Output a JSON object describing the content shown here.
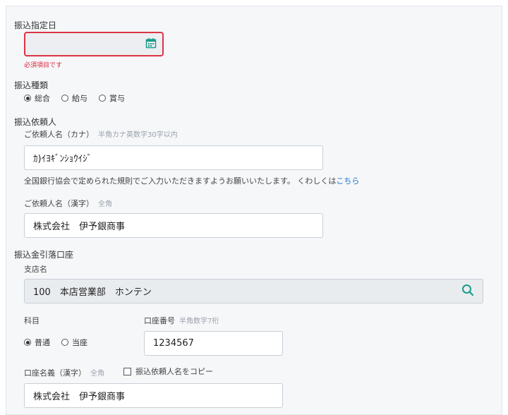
{
  "transfer_date": {
    "label": "振込指定日",
    "value": "",
    "error": "必須項目です"
  },
  "transfer_type": {
    "label": "振込種類",
    "options": [
      "総合",
      "給与",
      "賞与"
    ],
    "selected": 0
  },
  "requester": {
    "label": "振込依頼人",
    "kana": {
      "label": "ご依頼人名（カナ）",
      "hint": "半角カナ英数字30字以内",
      "value": "ｶ)ｲﾖｷﾞﾝｼｮｳｲｼﾞ"
    },
    "notice_text": "全国銀行協会で定められた規則でご入力いただきますようお願いいたします。 くわしくは",
    "notice_link": "こちら",
    "kanji": {
      "label": "ご依頼人名（漢字）",
      "hint": "全角",
      "value": "株式会社　伊予銀商事"
    }
  },
  "account": {
    "label": "振込金引落口座",
    "branch": {
      "label": "支店名",
      "value": "100　本店営業部　ホンテン"
    },
    "subject": {
      "label": "科目",
      "options": [
        "普通",
        "当座"
      ],
      "selected": 0
    },
    "number": {
      "label": "口座番号",
      "hint": "半角数字7桁",
      "value": "1234567"
    },
    "name": {
      "label": "口座名義（漢字）",
      "hint": "全角",
      "value": "株式会社　伊予銀商事",
      "copy_label": "振込依頼人名をコピー"
    }
  },
  "colors": {
    "error": "#dc3545",
    "accent": "#1a9c8c",
    "link": "#1a73c8"
  }
}
